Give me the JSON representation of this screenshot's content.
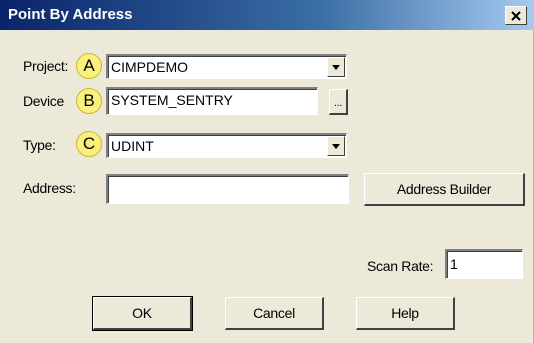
{
  "window": {
    "title": "Point By Address",
    "close_icon": "close-icon"
  },
  "project": {
    "label": "Project:",
    "badge": "A",
    "value": "CIMPDEMO"
  },
  "device": {
    "label": "Device",
    "badge": "B",
    "value": "SYSTEM_SENTRY",
    "browse_label": "..."
  },
  "type": {
    "label": "Type:",
    "badge": "C",
    "value": "UDINT"
  },
  "address": {
    "label": "Address:",
    "value": "",
    "builder_label": "Address Builder"
  },
  "scan_rate": {
    "label": "Scan Rate:",
    "value": "1"
  },
  "buttons": {
    "ok": "OK",
    "cancel": "Cancel",
    "help": "Help"
  },
  "colors": {
    "badge_fill": "#fbf07d",
    "dialog_bg": "#ece9d8",
    "titlebar_start": "#0a246a",
    "titlebar_end": "#a6caf0"
  }
}
